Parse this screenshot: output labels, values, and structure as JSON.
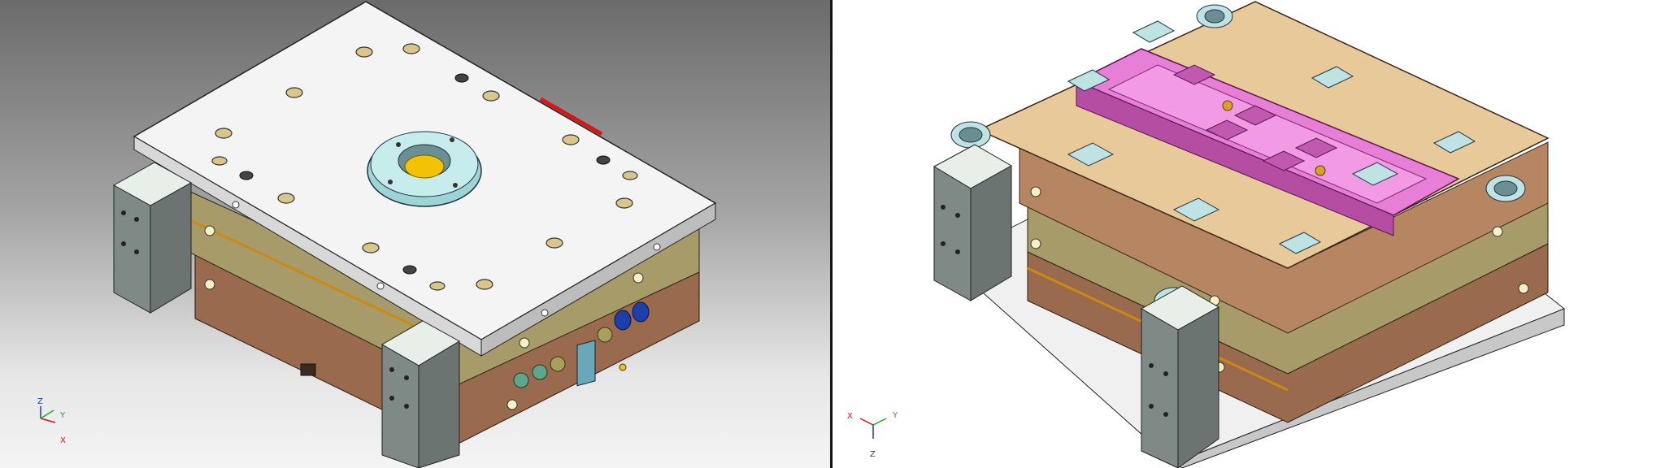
{
  "viewports": {
    "left": {
      "background_top": "#6b6b6b",
      "background_bottom": "#f4f4f4",
      "triad": {
        "z": "Z",
        "y": "Y",
        "x": "X"
      }
    },
    "right": {
      "background": "#ffffff",
      "triad": {
        "x": "X",
        "y": "Y",
        "z": "Z"
      }
    }
  },
  "colors": {
    "plate_white": "#f4f4f4",
    "plate_olive": "#a89b6a",
    "plate_brown": "#9a6a4e",
    "plate_tan": "#e8c99a",
    "block_gray": "#7f8a86",
    "cavity_pink": "#e77fd6",
    "pad_cyan": "#bfe3e3",
    "accent_red": "#d21818",
    "accent_yellow": "#f2c400",
    "accent_blue": "#1c3fa8"
  }
}
